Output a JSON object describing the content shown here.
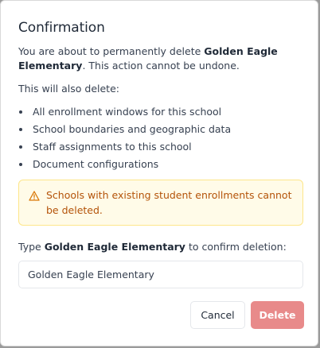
{
  "dialog": {
    "title": "Confirmation",
    "intro_prefix": "You are about to permanently delete ",
    "school_name": "Golden Eagle Elementary",
    "intro_suffix": ". This action cannot be undone.",
    "also_delete_label": "This will also delete:",
    "items": [
      "All enrollment windows for this school",
      "School boundaries and geographic data",
      "Staff assignments to this school",
      "Document configurations"
    ],
    "warning": {
      "icon": "warning-triangle-icon",
      "text": "Schools with existing student enrollments cannot be deleted."
    },
    "type_prefix": "Type ",
    "type_suffix": " to confirm deletion:",
    "confirm_input": {
      "value": "Golden Eagle Elementary"
    },
    "cancel_label": "Cancel",
    "delete_label": "Delete"
  },
  "colors": {
    "warning_background": "#fffbe8",
    "warning_border": "#fde68a",
    "warning_text": "#b45309",
    "delete_button_disabled": "#e88a8a"
  }
}
